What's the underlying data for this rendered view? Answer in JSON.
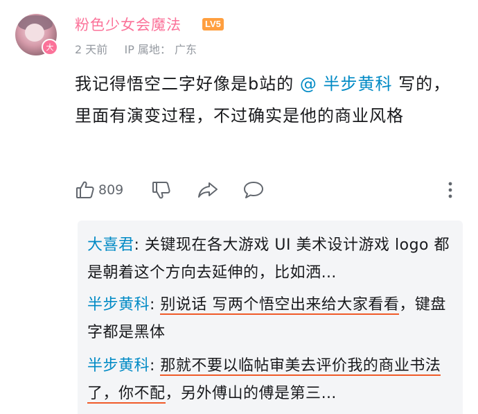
{
  "user": {
    "name": "粉色少女会魔法",
    "level": "LV5",
    "avatar_badge": "大",
    "time": "2 天前",
    "ip_label": "IP 属地：",
    "ip_location": "广东"
  },
  "comment": {
    "text_before": "我记得悟空二字好像是b站的",
    "mention": "@ 半步黄科",
    "text_after": " 写的，里面有演变过程，不过确实是他的商业风格"
  },
  "actions": {
    "like_count": "809",
    "like_icon": "thumbs-up-icon",
    "dislike_icon": "thumbs-down-icon",
    "share_icon": "share-icon",
    "reply_icon": "comment-icon",
    "more_icon": "more-vertical-icon"
  },
  "replies": [
    {
      "author": "大喜君",
      "sep": ": ",
      "text": "关键现在各大游戏 UI 美术设计游戏 logo 都是朝着这个方向去延伸的，比如洒…"
    },
    {
      "author": "半步黄科",
      "sep": ": ",
      "text_underlined": "别说话 写两个悟空出来给大家看看",
      "text_rest": "，键盘字都是黑体"
    },
    {
      "author": "半步黄科",
      "sep": ": ",
      "text_underlined": "那就不要以临帖审美去评价我的商业书法了，你不配",
      "text_rest": "，另外傅山的傅是第三…"
    }
  ],
  "colors": {
    "username": "#fb7299",
    "mention": "#008ac5",
    "underline": "#f05a28",
    "level_badge": "#ff9f3f"
  }
}
